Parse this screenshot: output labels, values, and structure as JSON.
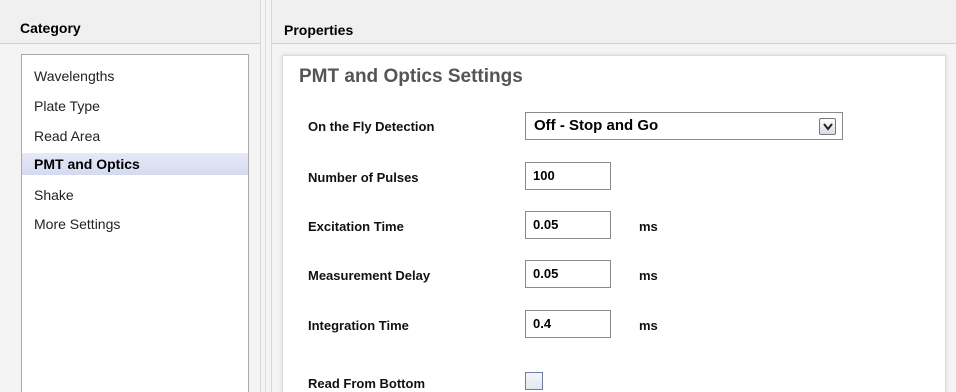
{
  "category_pane": {
    "header": "Category",
    "items": [
      {
        "label": "Wavelengths",
        "selected": false
      },
      {
        "label": "Plate Type",
        "selected": false
      },
      {
        "label": "Read Area",
        "selected": false
      },
      {
        "label": "PMT and Optics",
        "selected": true
      },
      {
        "label": "Shake",
        "selected": false
      },
      {
        "label": "More Settings",
        "selected": false
      }
    ]
  },
  "properties_pane": {
    "header": "Properties",
    "section_title": "PMT and Optics Settings",
    "on_the_fly": {
      "label": "On the Fly Detection",
      "value": "Off - Stop and Go"
    },
    "pulses": {
      "label": "Number of Pulses",
      "value": "100"
    },
    "excitation": {
      "label": "Excitation Time",
      "value": "0.05",
      "unit": "ms"
    },
    "delay": {
      "label": "Measurement Delay",
      "value": "0.05",
      "unit": "ms"
    },
    "integration": {
      "label": "Integration Time",
      "value": "0.4",
      "unit": "ms"
    },
    "read_bottom": {
      "label": "Read From Bottom",
      "checked": false
    }
  },
  "colors": {
    "selected_item_bg": "#d5daf0",
    "pane_bg": "#f4f4f4",
    "section_title": "#555555"
  }
}
